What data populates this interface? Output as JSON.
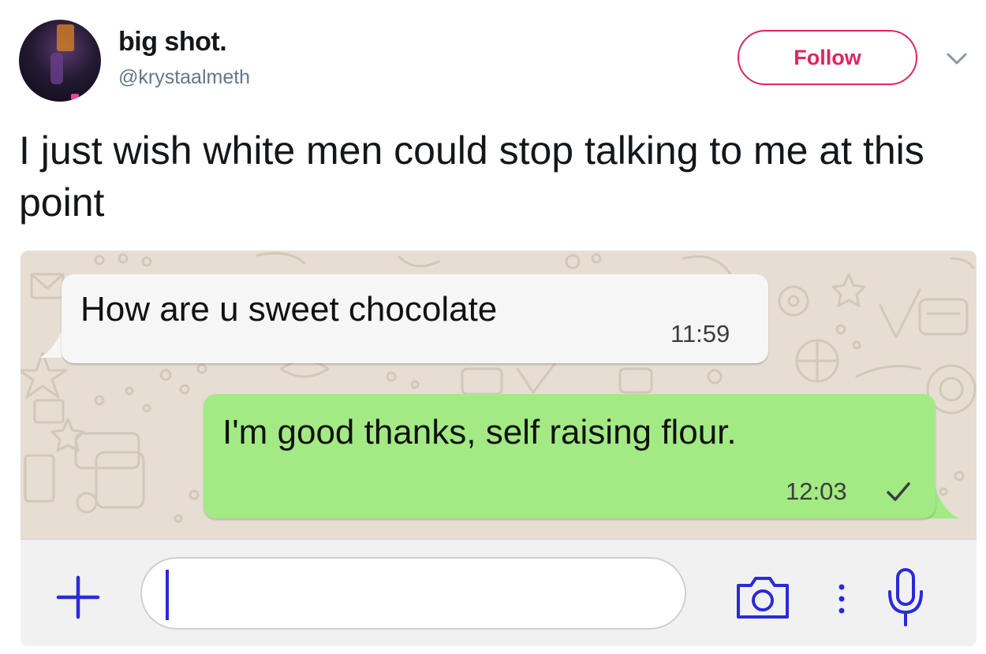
{
  "header": {
    "display_name": "big shot.",
    "handle": "@krystaalmeth",
    "follow_label": "Follow",
    "menu_icon": "chevron-down-icon"
  },
  "tweet": {
    "text": "I just wish white men could stop talking to me at this point"
  },
  "chat": {
    "messages": [
      {
        "direction": "incoming",
        "text": "How are u sweet chocolate",
        "time": "11:59"
      },
      {
        "direction": "outgoing",
        "text": "I'm good thanks, self raising flour.",
        "time": "12:03",
        "status_icon": "single-check-icon"
      }
    ],
    "input": {
      "value": "",
      "left_icon": "plus-icon",
      "right_icons": [
        "camera-icon",
        "more-dots-icon",
        "microphone-icon"
      ]
    }
  },
  "colors": {
    "follow_accent": "#e0245e",
    "incoming_bubble": "#f6f6f6",
    "outgoing_bubble": "#a3ea85",
    "chat_wallpaper": "#e6ddd3",
    "input_icons": "#2a2ad8"
  }
}
